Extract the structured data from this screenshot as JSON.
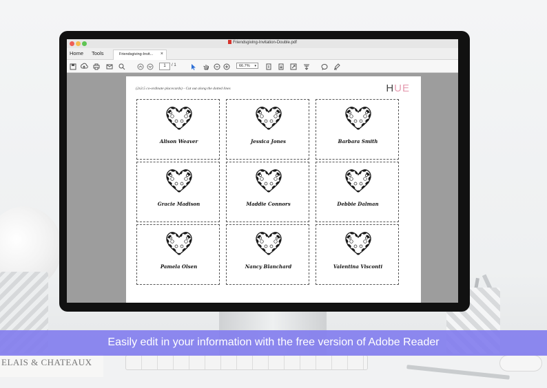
{
  "window": {
    "title": "Friendsgiving-Invitation-Double.pdf"
  },
  "nav": {
    "home": "Home",
    "tools": "Tools"
  },
  "tab": {
    "label": "Friendsgiving-Invit...",
    "close": "×"
  },
  "toolbar": {
    "page_current": "1",
    "page_total": "/ 1",
    "zoom": "66.7%",
    "zoom_caret": "▾"
  },
  "document": {
    "instructions": "(2x3.5 co-ordinate placecards) - Cut out along the dotted lines",
    "logo_h": "H",
    "logo_ue": "UE",
    "cards": [
      {
        "name": "Alison Weaver"
      },
      {
        "name": "Jessica Jones"
      },
      {
        "name": "Barbara Smith"
      },
      {
        "name": "Gracie Madison"
      },
      {
        "name": "Maddie Connors"
      },
      {
        "name": "Debbie Dalman"
      },
      {
        "name": "Pamela Olsen"
      },
      {
        "name": "Nancy Blanchard"
      },
      {
        "name": "Valentina Visconti"
      }
    ]
  },
  "banner": {
    "text": "Easily edit in your information with the free version of Adobe Reader"
  },
  "background": {
    "book_text": "ELAIS & CHATEAUX"
  },
  "icons": [
    "save-icon",
    "upload-icon",
    "print-icon",
    "mail-icon",
    "search-icon",
    "page-up-icon",
    "page-down-icon",
    "select-cursor-icon",
    "hand-icon",
    "zoom-out-icon",
    "zoom-in-icon",
    "fit-page-icon",
    "scroll-mode-icon",
    "fullscreen-icon",
    "read-mode-icon",
    "comment-icon",
    "pen-icon"
  ],
  "colors": {
    "banner": "#837eee",
    "logo_accent": "#e59bb0",
    "select_tool": "#2d6fd6"
  }
}
